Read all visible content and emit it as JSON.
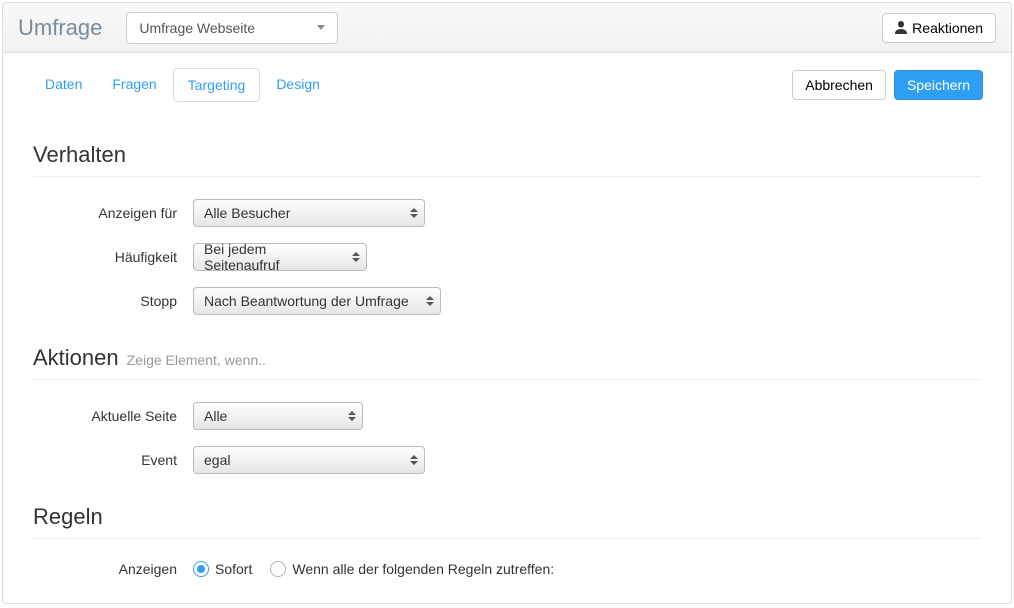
{
  "header": {
    "title": "Umfrage",
    "survey_dropdown_value": "Umfrage Webseite",
    "reactions_button": "Reaktionen"
  },
  "tabs": {
    "items": [
      {
        "label": "Daten",
        "active": false
      },
      {
        "label": "Fragen",
        "active": false
      },
      {
        "label": "Targeting",
        "active": true
      },
      {
        "label": "Design",
        "active": false
      }
    ]
  },
  "actions": {
    "cancel": "Abbrechen",
    "save": "Speichern"
  },
  "sections": {
    "behavior": {
      "title": "Verhalten",
      "fields": {
        "show_for_label": "Anzeigen für",
        "show_for_value": "Alle Besucher",
        "frequency_label": "Häufigkeit",
        "frequency_value": "Bei jedem Seitenaufruf",
        "stop_label": "Stopp",
        "stop_value": "Nach Beantwortung der Umfrage"
      }
    },
    "actions_section": {
      "title": "Aktionen",
      "subtitle": "Zeige Element, wenn..",
      "fields": {
        "current_page_label": "Aktuelle Seite",
        "current_page_value": "Alle",
        "event_label": "Event",
        "event_value": "egal"
      }
    },
    "rules": {
      "title": "Regeln",
      "show_label": "Anzeigen",
      "option_immediately": "Sofort",
      "option_conditional": "Wenn alle der folgenden Regeln zutreffen:"
    }
  }
}
